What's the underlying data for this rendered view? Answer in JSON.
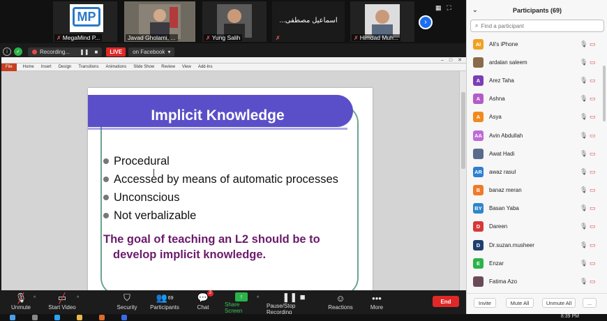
{
  "video_strip": {
    "tiles": [
      {
        "name": "MegaMind P..."
      },
      {
        "name": "Javad Gholami, ..."
      },
      {
        "name": "Yung Salih"
      },
      {
        "name": "...اسماعیل مصطفی"
      },
      {
        "name": "Himdad Muh..."
      }
    ]
  },
  "status": {
    "recording": "Recording...",
    "live": "LIVE",
    "stream": "on Facebook"
  },
  "ppt": {
    "file_tab": "File",
    "tabs": [
      "Home",
      "Insert",
      "Design",
      "Transitions",
      "Animations",
      "Slide Show",
      "Review",
      "View",
      "Add-Ins"
    ]
  },
  "slide": {
    "title": "Implicit Knowledge",
    "bullets": [
      "Procedural",
      "Accessed by means of automatic processes",
      "Unconscious",
      "Not verbalizable"
    ],
    "goal_line1": "The goal of teaching an L2 should be to",
    "goal_line2": "develop implicit knowledge."
  },
  "toolbar": {
    "unmute": "Unmute",
    "start_video": "Start Video",
    "security": "Security",
    "participants": "Participants",
    "participants_count": "69",
    "chat": "Chat",
    "chat_badge": "2",
    "share_screen": "Share Screen",
    "pause_recording": "Pause/Stop Recording",
    "reactions": "Reactions",
    "more": "More",
    "end": "End"
  },
  "panel": {
    "title": "Participants (69)",
    "search_placeholder": "Find a participant",
    "participants": [
      {
        "initials": "AI",
        "name": "Ali's iPhone",
        "color": "#f0a020"
      },
      {
        "initials": "",
        "name": "ardalan saleem",
        "color": "#8a6a4a"
      },
      {
        "initials": "A",
        "name": "Arez Taha",
        "color": "#7a3fb5"
      },
      {
        "initials": "A",
        "name": "Ashna",
        "color": "#b35cc9"
      },
      {
        "initials": "A",
        "name": "Asya",
        "color": "#f08a1c"
      },
      {
        "initials": "AA",
        "name": "Avin Abdullah",
        "color": "#c06ad6"
      },
      {
        "initials": "",
        "name": "Awat Hadi",
        "color": "#5a6a8a"
      },
      {
        "initials": "AR",
        "name": "awaz rasul",
        "color": "#2f7fd0"
      },
      {
        "initials": "B",
        "name": "banaz meran",
        "color": "#f07a2a"
      },
      {
        "initials": "BY",
        "name": "Basan Yaba",
        "color": "#2f86c9"
      },
      {
        "initials": "D",
        "name": "Dareen",
        "color": "#d83838"
      },
      {
        "initials": "D",
        "name": "Dr.suzan.musheer",
        "color": "#1e3f6e"
      },
      {
        "initials": "E",
        "name": "Enzar",
        "color": "#2bb34a"
      },
      {
        "initials": "",
        "name": "Fatima Azo",
        "color": "#6a4a5a"
      }
    ],
    "invite": "Invite",
    "mute_all": "Mute All",
    "unmute_all": "Unmute All",
    "more": "..."
  },
  "taskbar": {
    "clock": "8:39 PM"
  }
}
